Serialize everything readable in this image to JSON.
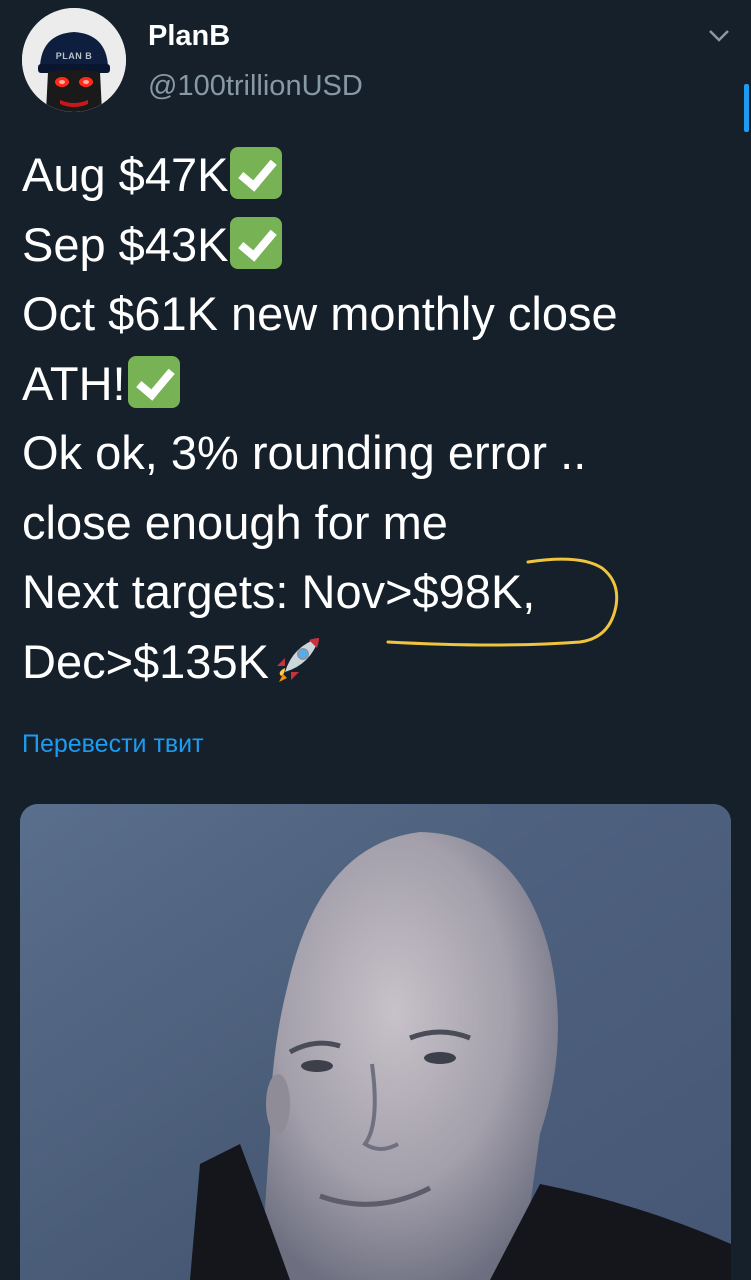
{
  "tweet": {
    "author": {
      "display_name": "PlanB",
      "handle": "@100trillionUSD",
      "avatar_cap_text": "PLAN B"
    },
    "lines": [
      "Aug $47K",
      "Sep $43K",
      "Oct $61K new monthly close",
      "ATH!",
      "Ok ok, 3% rounding error ..",
      "close enough for me",
      "Next targets: Nov>$98K,",
      "Dec>$135K"
    ],
    "translate_label": "Перевести твит",
    "icons": {
      "menu": "chevron-down-icon",
      "check": "check-mark-emoji",
      "rocket": "rocket-emoji"
    },
    "colors": {
      "background": "#15202b",
      "text": "#ffffff",
      "secondary_text": "#8899a6",
      "link": "#1d9bf0",
      "check_emoji": "#77b255",
      "highlight_stroke": "#f0c43c"
    }
  }
}
